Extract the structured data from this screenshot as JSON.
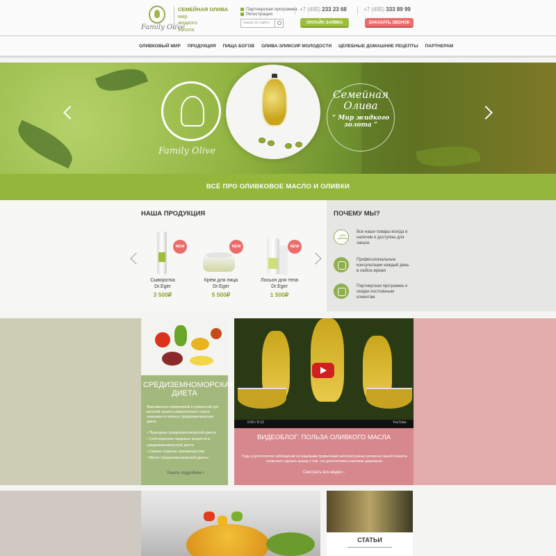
{
  "header": {
    "logo_script": "Family Olive",
    "tagline_bold": "СЕМЕЙНАЯ ОЛИВА",
    "tagline_lines": [
      "мир",
      "жидкого",
      "золота"
    ],
    "link_partner": "Партнерская программа",
    "link_register": "Регистрация",
    "search_placeholder": "поиск по сайту",
    "phone1_prefix": "+7 (495)",
    "phone1_number": "233 23 68",
    "phone2_prefix": "+7 (495)",
    "phone2_number": "333 89 99",
    "btn_order": "ОНЛАЙН ЗАЯВКА",
    "btn_call": "ЗАКАЗАТЬ ЗВОНОК"
  },
  "nav": {
    "items": [
      "ОЛИВКОВЫЙ МИР",
      "ПРОДУКЦИЯ",
      "ПИЩА БОГОВ",
      "ОЛИВА-ЭЛИКСИР МОЛОДОСТИ",
      "ЦЕЛЕБНЫЕ ДОМАШНИЕ РЕЦЕПТЫ",
      "ПАРТНЕРАМ"
    ]
  },
  "hero": {
    "script_logo": "Family Olive",
    "title": "Семейная Олива",
    "subtitle": "Мир жидкого золота",
    "quote_open": "“",
    "quote_close": "”"
  },
  "band": {
    "text": "ВСЁ ПРО ОЛИВКОВОЕ МАСЛО И ОЛИВКИ"
  },
  "products": {
    "title": "НАША ПРОДУКЦИЯ",
    "badge": "NEW",
    "items": [
      {
        "name1": "Сыворотка",
        "name2": "Dr.Eger",
        "price": "3 500₽"
      },
      {
        "name1": "Крем для лица",
        "name2": "Dr.Eger",
        "price": "5 500₽"
      },
      {
        "name1": "Лосьон для тела",
        "name2": "Dr.Eger",
        "price": "1 500₽"
      }
    ]
  },
  "why": {
    "title": "ПОЧЕМУ МЫ?",
    "badge_text": "100% гарантия",
    "items": [
      "Все наши товары всегда в наличии и доступны для заказа",
      "Профессиональные консультации каждый день в любое время",
      "Партнерская программа и скидки постоянным клиентам"
    ]
  },
  "diet": {
    "title": "СРЕДИЗЕМНОМОРСКАЯ ДИЕТА",
    "text": "Максимально приемлемой и привычной для жителей нашего климатического пояса оказывается именно средиземноморская диета.",
    "list": [
      "Принципы средиземноморской диеты",
      "Соотношение пищевых веществ в средиземноморской диете",
      "Самые главные преимущества",
      "Меню средиземноморской диеты"
    ],
    "more": "Узнать подробнее  ›"
  },
  "video": {
    "time": "0:00 / 8:13",
    "logo": "YouTube",
    "title": "ВИДЕОБЛОГ: ПОЛЬЗА ОЛИВКОГО МАСЛА",
    "text": "Годы и десятилетия наблюдений за пищевыми привычками жителей разных регионов нашей планеты позволяют сделать вывод о том, что долголетием и крепким здоровьем.",
    "more": "Смотреть все видео  ›"
  },
  "articles": {
    "title": "СТАТЬИ"
  },
  "colors": {
    "accent_green": "#93b73a",
    "accent_red": "#ec6c6c",
    "diet_green": "#a3b87c",
    "blog_pink": "#d7888c"
  }
}
